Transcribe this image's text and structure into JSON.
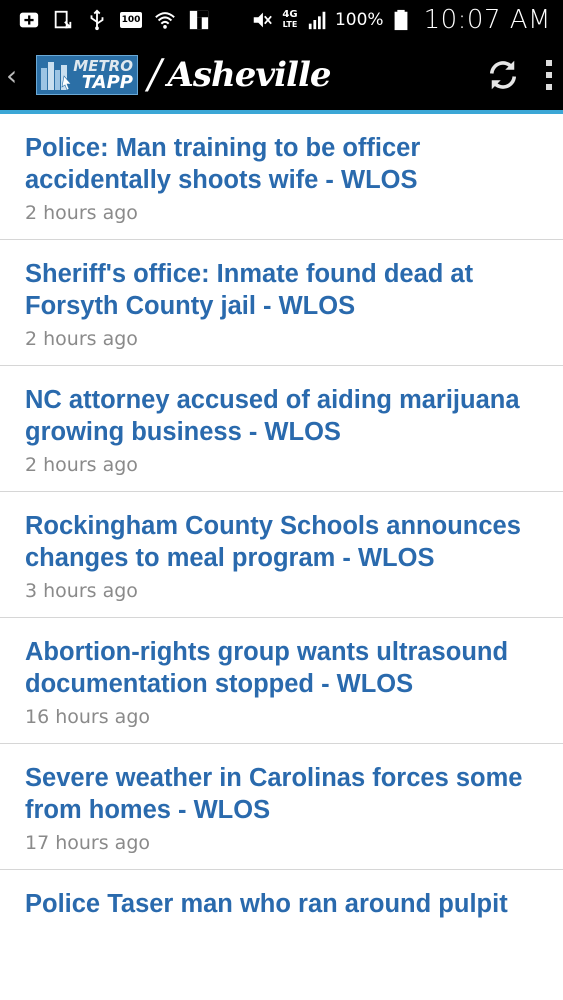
{
  "status_bar": {
    "battery_percent": "100%",
    "time": "10:07 AM",
    "network_label": "4G",
    "network_sub": "LTE",
    "badge": "100",
    "icons": [
      "add-box-icon",
      "download-icon",
      "usb-icon",
      "battery-badge-icon",
      "wifi-icon",
      "flipboard-icon",
      "mute-icon",
      "signal-icon",
      "battery-icon"
    ]
  },
  "app_bar": {
    "logo_top": "METRO",
    "logo_bottom": "TAPP",
    "slash": "/",
    "city": "Asheville",
    "accent_color": "#3ba7d6"
  },
  "news": [
    {
      "title": "Police: Man training to be officer accidentally shoots wife - WLOS",
      "time": "2 hours ago"
    },
    {
      "title": "Sheriff's office: Inmate found dead at Forsyth County jail - WLOS",
      "time": "2 hours ago"
    },
    {
      "title": "NC attorney accused of aiding marijuana growing business - WLOS",
      "time": "2 hours ago"
    },
    {
      "title": "Rockingham County Schools announces changes to meal program - WLOS",
      "time": "3 hours ago"
    },
    {
      "title": "Abortion-rights group wants ultrasound documentation stopped - WLOS",
      "time": "16 hours ago"
    },
    {
      "title": "Severe weather in Carolinas forces some from homes - WLOS",
      "time": "17 hours ago"
    },
    {
      "title": "Police Taser man who ran around pulpit",
      "time": ""
    }
  ],
  "colors": {
    "headline": "#2a6aad",
    "timestamp": "#8a8a8a",
    "divider": "#d6d6d6"
  }
}
